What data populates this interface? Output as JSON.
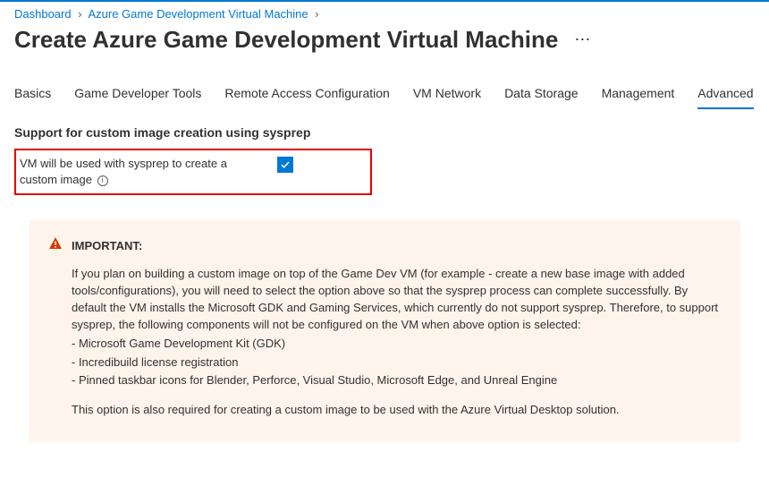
{
  "breadcrumb": {
    "items": [
      "Dashboard",
      "Azure Game Development Virtual Machine"
    ]
  },
  "page": {
    "title": "Create Azure Game Development Virtual Machine"
  },
  "tabs": {
    "items": [
      {
        "label": "Basics",
        "active": false
      },
      {
        "label": "Game Developer Tools",
        "active": false
      },
      {
        "label": "Remote Access Configuration",
        "active": false
      },
      {
        "label": "VM Network",
        "active": false
      },
      {
        "label": "Data Storage",
        "active": false
      },
      {
        "label": "Management",
        "active": false
      },
      {
        "label": "Advanced",
        "active": true
      }
    ]
  },
  "section": {
    "heading": "Support for custom image creation using sysprep",
    "field_label": "VM will be used with sysprep to create a custom image",
    "checkbox_checked": true
  },
  "important": {
    "title": "IMPORTANT:",
    "para1": "If you plan on building a custom image on top of the Game Dev VM (for example - create a new base image with added tools/configurations), you will need to select the option above so that the sysprep process can complete successfully. By default the VM installs the Microsoft GDK and Gaming Services, which currently do not support sysprep. Therefore, to support sysprep, the following components will not be configured on the VM when above option is selected:",
    "bullet1": "- Microsoft Game Development Kit (GDK)",
    "bullet2": "- Incredibuild license registration",
    "bullet3": "- Pinned taskbar icons for Blender, Perforce, Visual Studio, Microsoft Edge, and Unreal Engine",
    "para2": "This option is also required for creating a custom image to be used with the Azure Virtual Desktop solution."
  }
}
